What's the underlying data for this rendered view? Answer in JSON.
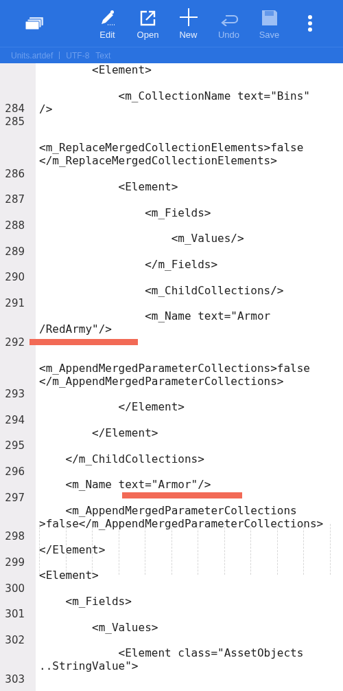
{
  "toolbar": {
    "actions": [
      {
        "kind": "edit",
        "label": "Edit",
        "disabled": false
      },
      {
        "kind": "open",
        "label": "Open",
        "disabled": false
      },
      {
        "kind": "new",
        "label": "New",
        "disabled": false
      },
      {
        "kind": "undo",
        "label": "Undo",
        "disabled": true
      },
      {
        "kind": "save",
        "label": "Save",
        "disabled": true
      }
    ]
  },
  "file_info": {
    "filename": "Units.artdef",
    "encoding": "UTF-8",
    "mode": "Text"
  },
  "rows": [
    {
      "code": "        <Element>"
    },
    {},
    {
      "code": "            <m_CollectionName text=\"Bins\""
    },
    {
      "number": "284",
      "code": "/>"
    },
    {
      "number": "285"
    },
    {},
    {
      "code": "<m_ReplaceMergedCollectionElements>false"
    },
    {
      "code": "</m_ReplaceMergedCollectionElements>"
    },
    {
      "number": "286"
    },
    {
      "code": "            <Element>"
    },
    {
      "number": "287"
    },
    {
      "code": "                <m_Fields>"
    },
    {
      "number": "288"
    },
    {
      "code": "                    <m_Values/>"
    },
    {
      "number": "289"
    },
    {
      "code": "                </m_Fields>"
    },
    {
      "number": "290"
    },
    {
      "code": "                <m_ChildCollections/>"
    },
    {
      "number": "291"
    },
    {
      "code": "                <m_Name text=\"Armor"
    },
    {
      "code": "/RedArmy\"/>"
    },
    {
      "number": "292",
      "marked": true
    },
    {},
    {
      "code": "<m_AppendMergedParameterCollections>false"
    },
    {
      "code": "</m_AppendMergedParameterCollections>"
    },
    {
      "number": "293"
    },
    {
      "code": "            </Element>"
    },
    {
      "number": "294"
    },
    {
      "code": "        </Element>"
    },
    {
      "number": "295"
    },
    {
      "code": "    </m_ChildCollections>"
    },
    {
      "number": "296"
    },
    {
      "code": "    <m_Name text=\"Armor\"/>"
    },
    {
      "number": "297",
      "marked": true
    },
    {
      "code": "    <m_AppendMergedParameterCollections"
    },
    {
      "code": ">false</m_AppendMergedParameterCollections>"
    },
    {
      "number": "298",
      "guides": true
    },
    {
      "code": "</Element>"
    },
    {
      "number": "299",
      "guides": true
    },
    {
      "code": "<Element>"
    },
    {
      "number": "300"
    },
    {
      "code": "    <m_Fields>"
    },
    {
      "number": "301"
    },
    {
      "code": "        <m_Values>"
    },
    {
      "number": "302"
    },
    {
      "code": "            <Element class=\"AssetObjects"
    },
    {
      "code": "..StringValue\">"
    },
    {
      "number": "303"
    }
  ]
}
